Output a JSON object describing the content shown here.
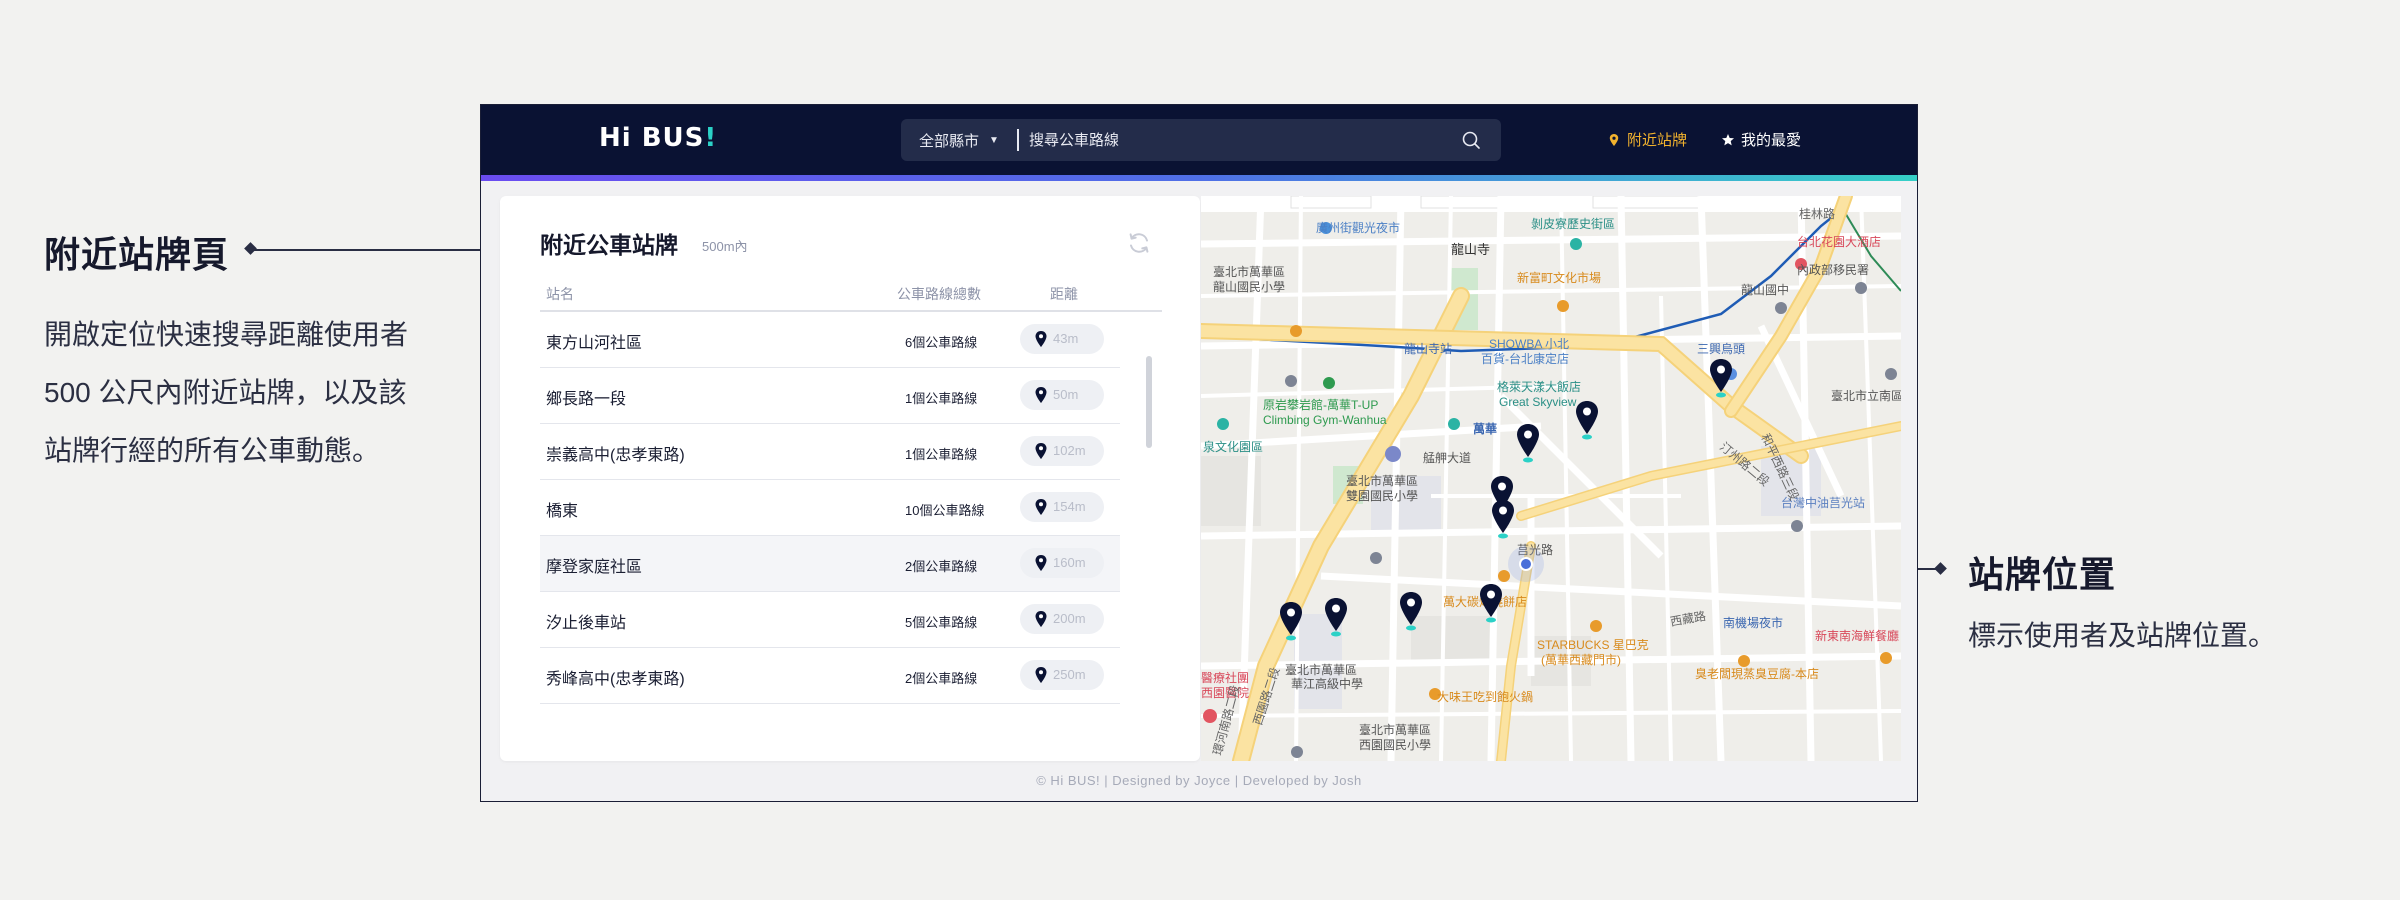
{
  "annotations": {
    "left": {
      "title": "附近站牌頁",
      "desc": [
        "開啟定位快速搜尋距離使用者",
        "500 公尺內附近站牌，以及該",
        "站牌行經的所有公車動態。"
      ]
    },
    "right": {
      "title": "站牌位置",
      "desc": "標示使用者及站牌位置。"
    }
  },
  "header": {
    "logo_main": "Hi BUS",
    "logo_accent": "!",
    "city_select": "全部縣市",
    "search_placeholder": "搜尋公車路線",
    "nav": {
      "nearby": "附近站牌",
      "favorites": "我的最愛"
    }
  },
  "panel": {
    "title": "附近公車站牌",
    "subtitle": "500m內",
    "columns": {
      "name": "站名",
      "count": "公車路線總數",
      "distance": "距離"
    },
    "rows": [
      {
        "name": "東方山河社區",
        "count": "6個公車路線",
        "distance": "43m"
      },
      {
        "name": "鄉長路一段",
        "count": "1個公車路線",
        "distance": "50m"
      },
      {
        "name": "崇義高中(忠孝東路)",
        "count": "1個公車路線",
        "distance": "102m"
      },
      {
        "name": "橋東",
        "count": "10個公車路線",
        "distance": "154m"
      },
      {
        "name": "摩登家庭社區",
        "count": "2個公車路線",
        "distance": "160m"
      },
      {
        "name": "汐止後車站",
        "count": "5個公車路線",
        "distance": "200m"
      },
      {
        "name": "秀峰高中(忠孝東路)",
        "count": "2個公車路線",
        "distance": "250m"
      }
    ]
  },
  "map": {
    "labels": [
      "廣州街觀光夜市",
      "龍山寺",
      "剝皮寮歷史街區",
      "桂林路",
      "台北花園大酒店",
      "臺北市萬華區",
      "龍山國民小學",
      "新富町文化市場",
      "龍山國中",
      "內政部移民署",
      "SHOWBA 小北",
      "百貨-台北康定店",
      "龍山寺站",
      "三興烏頭",
      "格萊天漾大飯店",
      "Great Skyview",
      "原岩攀岩館-萬華T-UP",
      "Climbing Gym-Wanhua",
      "萬華",
      "艋舺大道",
      "臺北市立南區",
      "泉文化園區",
      "台灣中油莒光站",
      "臺北市萬華區",
      "雙園國民小學",
      "莒光路",
      "萬大碳烤燒餅店",
      "南機場夜市",
      "新東南海鮮餐廳",
      "STARBUCKS 星巴克",
      "(萬華西藏門市)",
      "臭老闆現蒸臭豆腐-本店",
      "醫療社團",
      "西園醫院",
      "臺北市萬華區",
      "華江高級中學",
      "大味王吃到飽火鍋",
      "臺北市萬華區",
      "西園國民小學",
      "西園路二段",
      "環河南路二段",
      "和平西路三段",
      "汀州路二段",
      "西藏路"
    ]
  },
  "footer": "© Hi BUS! | Designed by Joyce | Developed by Josh"
}
